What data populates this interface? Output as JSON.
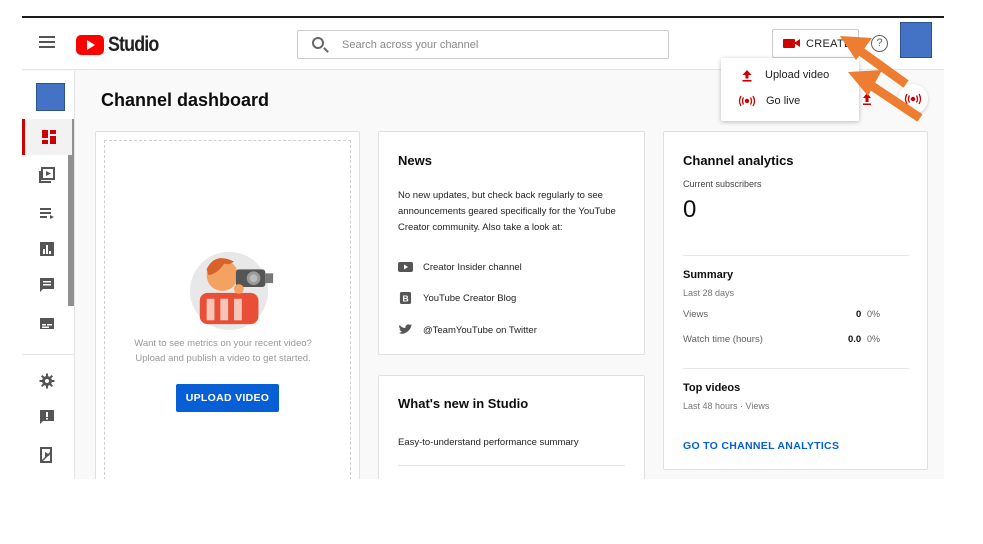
{
  "header": {
    "logo_text": "Studio",
    "search_placeholder": "Search across your channel",
    "create_label": "CREATE",
    "help_label": "?"
  },
  "create_menu": {
    "items": [
      {
        "label": "Upload video",
        "icon": "upload-icon"
      },
      {
        "label": "Go live",
        "icon": "go-live-icon"
      }
    ]
  },
  "sidebar": {
    "items": [
      {
        "name": "dashboard",
        "icon": "dashboard-icon",
        "active": true
      },
      {
        "name": "content",
        "icon": "content-icon"
      },
      {
        "name": "playlists",
        "icon": "playlists-icon"
      },
      {
        "name": "analytics",
        "icon": "analytics-icon"
      },
      {
        "name": "comments",
        "icon": "comments-icon"
      },
      {
        "name": "subtitles",
        "icon": "subtitles-icon"
      },
      {
        "name": "settings",
        "icon": "gear-icon"
      },
      {
        "name": "send-feedback",
        "icon": "feedback-icon"
      },
      {
        "name": "creator-studio-classic",
        "icon": "classic-icon"
      }
    ]
  },
  "main": {
    "title": "Channel dashboard",
    "upload_card": {
      "prompt": "Want to see metrics on your recent video? Upload and publish a video to get started.",
      "button": "UPLOAD VIDEO"
    },
    "news_card": {
      "title": "News",
      "body": "No new updates, but check back regularly to see announcements geared specifically for the YouTube Creator community. Also take a look at:",
      "links": [
        {
          "label": "Creator Insider channel",
          "icon": "youtube-icon"
        },
        {
          "label": "YouTube Creator Blog",
          "icon": "blogger-icon"
        },
        {
          "label": "@TeamYouTube on Twitter",
          "icon": "twitter-icon"
        }
      ]
    },
    "whats_new_card": {
      "title": "What's new in Studio",
      "item": "Easy-to-understand performance summary"
    },
    "analytics_card": {
      "title": "Channel analytics",
      "subscribers_label": "Current subscribers",
      "subscribers_value": "0",
      "summary_title": "Summary",
      "summary_period": "Last 28 days",
      "rows": [
        {
          "label": "Views",
          "value": "0",
          "pct": "0%"
        },
        {
          "label": "Watch time (hours)",
          "value": "0.0",
          "pct": "0%"
        }
      ],
      "top_videos_title": "Top videos",
      "top_videos_period": "Last 48 hours · Views",
      "link": "GO TO CHANNEL ANALYTICS"
    }
  },
  "colors": {
    "accent_blue": "#065fd4",
    "youtube_red": "#ff0000",
    "annotation_orange": "#ed7d31",
    "placeholder_blue": "#4472c4"
  }
}
